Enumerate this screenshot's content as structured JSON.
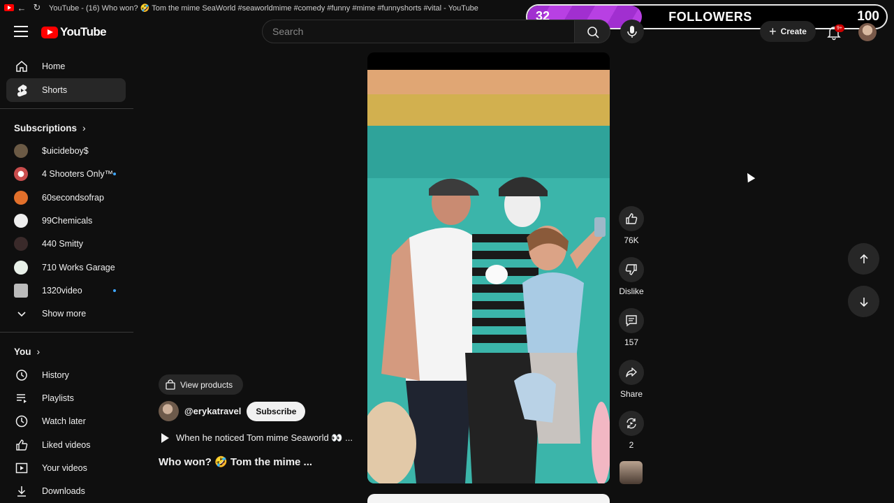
{
  "browser": {
    "tab_title": "YouTube - (16) Who won? 🤣 Tom the mime SeaWorld #seaworldmime #comedy #funny #mime #funnyshorts #vital - YouTube"
  },
  "overlay": {
    "followers_current": "32",
    "followers_label": "FOLLOWERS",
    "followers_goal": "100",
    "progress_fraction": 0.32
  },
  "header": {
    "logo_text": "YouTube",
    "search_placeholder": "Search",
    "create_label": "Create",
    "notifications_badge": "9+"
  },
  "sidebar": {
    "main": [
      {
        "label": "Home",
        "icon": "home-icon"
      },
      {
        "label": "Shorts",
        "icon": "shorts-icon",
        "active": true
      }
    ],
    "subscriptions_title": "Subscriptions",
    "subscriptions": [
      {
        "label": "$uicideboy$",
        "color": "#6b5a45",
        "dot": false
      },
      {
        "label": "4 Shooters Only™",
        "color": "#c94d4d",
        "dot": true
      },
      {
        "label": "60secondsofrap",
        "color": "#e2702b",
        "dot": false
      },
      {
        "label": "99Chemicals",
        "color": "#eeeeee",
        "dot": false
      },
      {
        "label": "440 Smitty",
        "color": "#3a2a2a",
        "dot": false
      },
      {
        "label": "710 Works Garage",
        "color": "#e8f0e8",
        "dot": false
      },
      {
        "label": "1320video",
        "color": "#bbbbbb",
        "dot": true
      }
    ],
    "show_more": "Show more",
    "you_title": "You",
    "you": [
      {
        "label": "History",
        "icon": "history-icon"
      },
      {
        "label": "Playlists",
        "icon": "playlists-icon"
      },
      {
        "label": "Watch later",
        "icon": "watch-later-icon"
      },
      {
        "label": "Liked videos",
        "icon": "liked-videos-icon"
      },
      {
        "label": "Your videos",
        "icon": "your-videos-icon"
      },
      {
        "label": "Downloads",
        "icon": "downloads-icon"
      }
    ]
  },
  "short": {
    "view_products": "View products",
    "channel": "@erykatravel",
    "subscribe": "Subscribe",
    "caption": "When he noticed Tom mime Seaworld 👀 ...",
    "title": "Who won? 🤣 Tom the mime ..."
  },
  "actions": {
    "likes": "76K",
    "dislike": "Dislike",
    "comments": "157",
    "share": "Share",
    "remix": "2"
  }
}
